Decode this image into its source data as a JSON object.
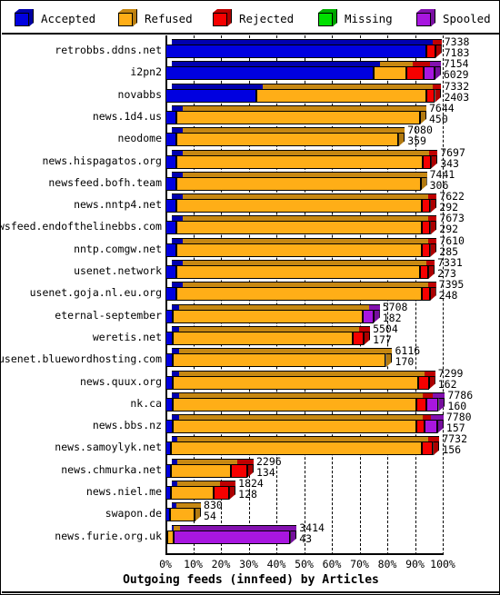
{
  "chart_data": {
    "type": "bar",
    "orientation": "horizontal",
    "stacked": true,
    "title": "Outgoing feeds (innfeed) by Articles",
    "xlabel": "Outgoing feeds (innfeed) by Articles",
    "ylabel": "",
    "xlim": [
      0,
      100
    ],
    "xunit": "%",
    "grid": true,
    "legend_position": "top",
    "xtick_labels": [
      "0%",
      "10%",
      "20%",
      "30%",
      "40%",
      "50%",
      "60%",
      "70%",
      "80%",
      "90%",
      "100%"
    ],
    "xtick_values": [
      0,
      10,
      20,
      30,
      40,
      50,
      60,
      70,
      80,
      90,
      100
    ],
    "series": [
      {
        "name": "Accepted",
        "color": "#0000E0"
      },
      {
        "name": "Refused",
        "color": "#FFAE17"
      },
      {
        "name": "Rejected",
        "color": "#F60000"
      },
      {
        "name": "Missing",
        "color": "#00E000"
      },
      {
        "name": "Spooled",
        "color": "#A816E0"
      }
    ],
    "categories": [
      "retrobbs.ddns.net",
      "i2pn2",
      "novabbs",
      "news.1d4.us",
      "neodome",
      "news.hispagatos.org",
      "newsfeed.bofh.team",
      "news.nntp4.net",
      "newsfeed.endofthelinebbs.com",
      "nntp.comgw.net",
      "usenet.network",
      "usenet.goja.nl.eu.org",
      "eternal-september",
      "weretis.net",
      "usenet.bluewordhosting.com",
      "news.quux.org",
      "nk.ca",
      "news.bbs.nz",
      "news.samoylyk.net",
      "news.chmurka.net",
      "news.niel.me",
      "swapon.de",
      "news.furie.org.uk"
    ],
    "rows": [
      {
        "label": "retrobbs.ddns.net",
        "total": 7338,
        "offered": 7183,
        "bar_pct": 97.3,
        "segments": [
          {
            "s": "Accepted",
            "pct": 94.0
          },
          {
            "s": "Rejected",
            "pct": 3.3
          }
        ]
      },
      {
        "label": "i2pn2",
        "total": 7154,
        "offered": 6029,
        "bar_pct": 97.0,
        "segments": [
          {
            "s": "Accepted",
            "pct": 75.0
          },
          {
            "s": "Refused",
            "pct": 12.0
          },
          {
            "s": "Rejected",
            "pct": 6.0
          },
          {
            "s": "Spooled",
            "pct": 4.0
          }
        ]
      },
      {
        "label": "novabbs",
        "total": 7332,
        "offered": 2403,
        "bar_pct": 97.2,
        "segments": [
          {
            "s": "Accepted",
            "pct": 32.8
          },
          {
            "s": "Refused",
            "pct": 61.4
          },
          {
            "s": "Rejected",
            "pct": 3.0
          }
        ]
      },
      {
        "label": "news.1d4.us",
        "total": 7644,
        "offered": 450,
        "bar_pct": 91.8,
        "segments": [
          {
            "s": "Accepted",
            "pct": 4.0
          },
          {
            "s": "Refused",
            "pct": 87.8
          }
        ]
      },
      {
        "label": "neodome",
        "total": 7080,
        "offered": 359,
        "bar_pct": 84.0,
        "segments": [
          {
            "s": "Accepted",
            "pct": 4.0
          },
          {
            "s": "Refused",
            "pct": 80.0
          }
        ]
      },
      {
        "label": "news.hispagatos.org",
        "total": 7697,
        "offered": 343,
        "bar_pct": 95.8,
        "segments": [
          {
            "s": "Accepted",
            "pct": 4.0
          },
          {
            "s": "Refused",
            "pct": 88.8
          },
          {
            "s": "Rejected",
            "pct": 3.0
          }
        ]
      },
      {
        "label": "newsfeed.bofh.team",
        "total": 7441,
        "offered": 306,
        "bar_pct": 92.0,
        "segments": [
          {
            "s": "Accepted",
            "pct": 4.0
          },
          {
            "s": "Refused",
            "pct": 88.0
          }
        ]
      },
      {
        "label": "news.nntp4.net",
        "total": 7622,
        "offered": 292,
        "bar_pct": 95.5,
        "segments": [
          {
            "s": "Accepted",
            "pct": 4.0
          },
          {
            "s": "Refused",
            "pct": 88.5
          },
          {
            "s": "Rejected",
            "pct": 3.0
          }
        ]
      },
      {
        "label": "newsfeed.endofthelinebbs.com",
        "total": 7673,
        "offered": 292,
        "bar_pct": 95.5,
        "segments": [
          {
            "s": "Accepted",
            "pct": 4.0
          },
          {
            "s": "Refused",
            "pct": 88.5
          },
          {
            "s": "Rejected",
            "pct": 3.0
          }
        ]
      },
      {
        "label": "nntp.comgw.net",
        "total": 7610,
        "offered": 285,
        "bar_pct": 95.5,
        "segments": [
          {
            "s": "Accepted",
            "pct": 4.0
          },
          {
            "s": "Refused",
            "pct": 88.5
          },
          {
            "s": "Rejected",
            "pct": 3.0
          }
        ]
      },
      {
        "label": "usenet.network",
        "total": 7331,
        "offered": 273,
        "bar_pct": 94.8,
        "segments": [
          {
            "s": "Accepted",
            "pct": 4.0
          },
          {
            "s": "Refused",
            "pct": 87.8
          },
          {
            "s": "Rejected",
            "pct": 3.0
          }
        ]
      },
      {
        "label": "usenet.goja.nl.eu.org",
        "total": 7395,
        "offered": 248,
        "bar_pct": 95.3,
        "segments": [
          {
            "s": "Accepted",
            "pct": 4.0
          },
          {
            "s": "Refused",
            "pct": 88.3
          },
          {
            "s": "Rejected",
            "pct": 3.0
          }
        ]
      },
      {
        "label": "eternal-september",
        "total": 5708,
        "offered": 182,
        "bar_pct": 75.0,
        "segments": [
          {
            "s": "Accepted",
            "pct": 2.5
          },
          {
            "s": "Refused",
            "pct": 68.5
          },
          {
            "s": "Spooled",
            "pct": 4.0
          }
        ]
      },
      {
        "label": "weretis.net",
        "total": 5504,
        "offered": 177,
        "bar_pct": 71.5,
        "segments": [
          {
            "s": "Accepted",
            "pct": 2.5
          },
          {
            "s": "Refused",
            "pct": 65.0
          },
          {
            "s": "Rejected",
            "pct": 4.0
          }
        ]
      },
      {
        "label": "usenet.bluewordhosting.com",
        "total": 6116,
        "offered": 170,
        "bar_pct": 79.5,
        "segments": [
          {
            "s": "Accepted",
            "pct": 2.5
          },
          {
            "s": "Refused",
            "pct": 77.0
          }
        ]
      },
      {
        "label": "news.quux.org",
        "total": 7299,
        "offered": 162,
        "bar_pct": 95.0,
        "segments": [
          {
            "s": "Accepted",
            "pct": 2.5
          },
          {
            "s": "Refused",
            "pct": 88.5
          },
          {
            "s": "Rejected",
            "pct": 4.0
          }
        ]
      },
      {
        "label": "nk.ca",
        "total": 7786,
        "offered": 160,
        "bar_pct": 98.5,
        "segments": [
          {
            "s": "Accepted",
            "pct": 2.5
          },
          {
            "s": "Refused",
            "pct": 88.0
          },
          {
            "s": "Rejected",
            "pct": 3.5
          },
          {
            "s": "Spooled",
            "pct": 4.5
          }
        ]
      },
      {
        "label": "news.bbs.nz",
        "total": 7780,
        "offered": 157,
        "bar_pct": 98.0,
        "segments": [
          {
            "s": "Accepted",
            "pct": 2.5
          },
          {
            "s": "Refused",
            "pct": 88.0
          },
          {
            "s": "Rejected",
            "pct": 3.0
          },
          {
            "s": "Spooled",
            "pct": 4.5
          }
        ]
      },
      {
        "label": "news.samoylyk.net",
        "total": 7732,
        "offered": 156,
        "bar_pct": 96.5,
        "segments": [
          {
            "s": "Accepted",
            "pct": 2.0
          },
          {
            "s": "Refused",
            "pct": 90.5
          },
          {
            "s": "Rejected",
            "pct": 4.0
          }
        ]
      },
      {
        "label": "news.chmurka.net",
        "total": 2296,
        "offered": 134,
        "bar_pct": 29.5,
        "segments": [
          {
            "s": "Accepted",
            "pct": 2.0
          },
          {
            "s": "Refused",
            "pct": 21.5
          },
          {
            "s": "Rejected",
            "pct": 6.0
          }
        ]
      },
      {
        "label": "news.niel.me",
        "total": 1824,
        "offered": 128,
        "bar_pct": 23.0,
        "segments": [
          {
            "s": "Accepted",
            "pct": 2.0
          },
          {
            "s": "Refused",
            "pct": 15.5
          },
          {
            "s": "Rejected",
            "pct": 5.5
          }
        ]
      },
      {
        "label": "swapon.de",
        "total": 830,
        "offered": 54,
        "bar_pct": 10.5,
        "segments": [
          {
            "s": "Accepted",
            "pct": 1.5
          },
          {
            "s": "Refused",
            "pct": 9.0
          }
        ]
      },
      {
        "label": "news.furie.org.uk",
        "total": 3414,
        "offered": 43,
        "bar_pct": 45.0,
        "segments": [
          {
            "s": "Accepted",
            "pct": 0.8
          },
          {
            "s": "Refused",
            "pct": 2.2
          },
          {
            "s": "Spooled",
            "pct": 42.0
          }
        ]
      }
    ]
  },
  "legend": {
    "items": [
      {
        "label": "Accepted",
        "color": "#0000E0",
        "icon": "cube-icon"
      },
      {
        "label": "Refused",
        "color": "#FFAE17",
        "icon": "cube-icon"
      },
      {
        "label": "Rejected",
        "color": "#F60000",
        "icon": "cube-icon"
      },
      {
        "label": "Missing",
        "color": "#00E000",
        "icon": "cube-icon"
      },
      {
        "label": "Spooled",
        "color": "#A816E0",
        "icon": "cube-icon"
      }
    ]
  },
  "axis": {
    "title": "Outgoing feeds (innfeed) by Articles",
    "ticks": [
      "0%",
      "10%",
      "20%",
      "30%",
      "40%",
      "50%",
      "60%",
      "70%",
      "80%",
      "90%",
      "100%"
    ]
  }
}
